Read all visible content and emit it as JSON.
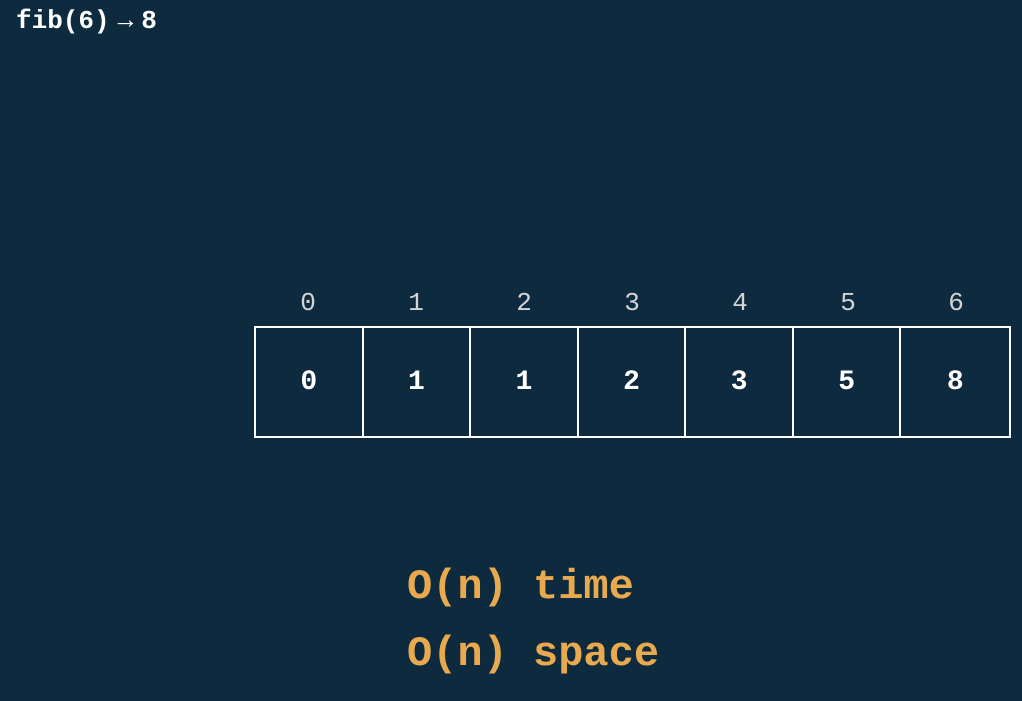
{
  "header": {
    "function_call": "fib(6)",
    "arrow": "→",
    "result": "8"
  },
  "table": {
    "indices": [
      "0",
      "1",
      "2",
      "3",
      "4",
      "5",
      "6"
    ],
    "values": [
      "0",
      "1",
      "1",
      "2",
      "3",
      "5",
      "8"
    ]
  },
  "complexity": {
    "time": "O(n) time",
    "space": "O(n) space"
  }
}
